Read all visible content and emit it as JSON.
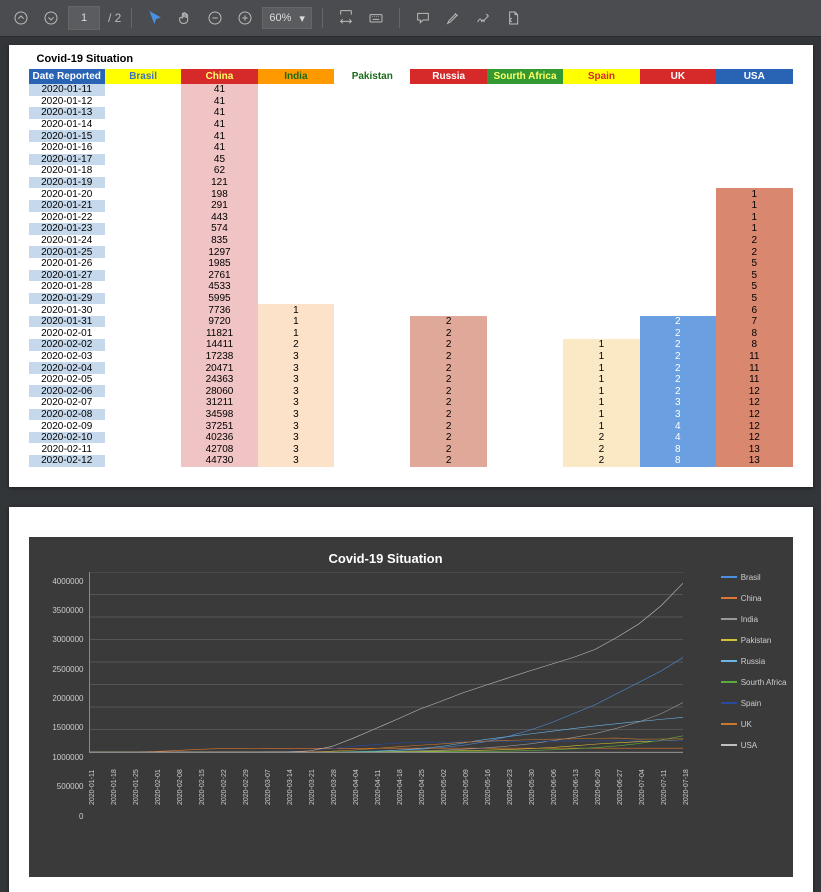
{
  "toolbar": {
    "page_current": "1",
    "page_total": "/ 2",
    "zoom": "60%"
  },
  "doc_title": "Covid-19 Situation",
  "columns": [
    {
      "key": "date",
      "label": "Date Reported",
      "bg": "#2963b4",
      "fg": "#ffffff"
    },
    {
      "key": "brasil",
      "label": "Brasil",
      "bg": "#ffff00",
      "fg": "#4070c0"
    },
    {
      "key": "china",
      "label": "China",
      "bg": "#d62a2a",
      "fg": "#ffff66"
    },
    {
      "key": "india",
      "label": "India",
      "bg": "#ff9900",
      "fg": "#1a6b1a"
    },
    {
      "key": "pakistan",
      "label": "Pakistan",
      "bg": "#ffffff",
      "fg": "#1a6b1a"
    },
    {
      "key": "russia",
      "label": "Russia",
      "bg": "#d62a2a",
      "fg": "#ffffff"
    },
    {
      "key": "sa",
      "label": "Sourth Africa",
      "bg": "#339933",
      "fg": "#ffff66"
    },
    {
      "key": "spain",
      "label": "Spain",
      "bg": "#ffff00",
      "fg": "#d62a2a"
    },
    {
      "key": "uk",
      "label": "UK",
      "bg": "#d62a2a",
      "fg": "#ffffff"
    },
    {
      "key": "usa",
      "label": "USA",
      "bg": "#2963b4",
      "fg": "#ffffff"
    }
  ],
  "cell_bg": {
    "china": "#f0c4c4",
    "india": "#fbe2c8",
    "russia": "#e0a898",
    "spain": "#fbe9c6",
    "uk": "#6aa0e2",
    "usa": "#d9886f"
  },
  "rows": [
    {
      "date": "2020-01-11",
      "china": "41"
    },
    {
      "date": "2020-01-12",
      "china": "41"
    },
    {
      "date": "2020-01-13",
      "china": "41"
    },
    {
      "date": "2020-01-14",
      "china": "41"
    },
    {
      "date": "2020-01-15",
      "china": "41"
    },
    {
      "date": "2020-01-16",
      "china": "41"
    },
    {
      "date": "2020-01-17",
      "china": "45"
    },
    {
      "date": "2020-01-18",
      "china": "62"
    },
    {
      "date": "2020-01-19",
      "china": "121"
    },
    {
      "date": "2020-01-20",
      "china": "198",
      "usa": "1"
    },
    {
      "date": "2020-01-21",
      "china": "291",
      "usa": "1"
    },
    {
      "date": "2020-01-22",
      "china": "443",
      "usa": "1"
    },
    {
      "date": "2020-01-23",
      "china": "574",
      "usa": "1"
    },
    {
      "date": "2020-01-24",
      "china": "835",
      "usa": "2"
    },
    {
      "date": "2020-01-25",
      "china": "1297",
      "usa": "2"
    },
    {
      "date": "2020-01-26",
      "china": "1985",
      "usa": "5"
    },
    {
      "date": "2020-01-27",
      "china": "2761",
      "usa": "5"
    },
    {
      "date": "2020-01-28",
      "china": "4533",
      "usa": "5"
    },
    {
      "date": "2020-01-29",
      "china": "5995",
      "usa": "5"
    },
    {
      "date": "2020-01-30",
      "china": "7736",
      "india": "1",
      "usa": "6"
    },
    {
      "date": "2020-01-31",
      "china": "9720",
      "india": "1",
      "russia": "2",
      "uk": "2",
      "usa": "7"
    },
    {
      "date": "2020-02-01",
      "china": "11821",
      "india": "1",
      "russia": "2",
      "uk": "2",
      "usa": "8"
    },
    {
      "date": "2020-02-02",
      "china": "14411",
      "india": "2",
      "russia": "2",
      "spain": "1",
      "uk": "2",
      "usa": "8"
    },
    {
      "date": "2020-02-03",
      "china": "17238",
      "india": "3",
      "russia": "2",
      "spain": "1",
      "uk": "2",
      "usa": "11"
    },
    {
      "date": "2020-02-04",
      "china": "20471",
      "india": "3",
      "russia": "2",
      "spain": "1",
      "uk": "2",
      "usa": "11"
    },
    {
      "date": "2020-02-05",
      "china": "24363",
      "india": "3",
      "russia": "2",
      "spain": "1",
      "uk": "2",
      "usa": "11"
    },
    {
      "date": "2020-02-06",
      "china": "28060",
      "india": "3",
      "russia": "2",
      "spain": "1",
      "uk": "2",
      "usa": "12"
    },
    {
      "date": "2020-02-07",
      "china": "31211",
      "india": "3",
      "russia": "2",
      "spain": "1",
      "uk": "3",
      "usa": "12"
    },
    {
      "date": "2020-02-08",
      "china": "34598",
      "india": "3",
      "russia": "2",
      "spain": "1",
      "uk": "3",
      "usa": "12"
    },
    {
      "date": "2020-02-09",
      "china": "37251",
      "india": "3",
      "russia": "2",
      "spain": "1",
      "uk": "4",
      "usa": "12"
    },
    {
      "date": "2020-02-10",
      "china": "40236",
      "india": "3",
      "russia": "2",
      "spain": "2",
      "uk": "4",
      "usa": "12"
    },
    {
      "date": "2020-02-11",
      "china": "42708",
      "india": "3",
      "russia": "2",
      "spain": "2",
      "uk": "8",
      "usa": "13"
    },
    {
      "date": "2020-02-12",
      "china": "44730",
      "india": "3",
      "russia": "2",
      "spain": "2",
      "uk": "8",
      "usa": "13"
    }
  ],
  "chart_data": {
    "type": "line",
    "title": "Covid-19 Situation",
    "ylabel": "",
    "xlabel": "",
    "ylim": [
      0,
      4000000
    ],
    "yticks": [
      0,
      500000,
      1000000,
      1500000,
      2000000,
      2500000,
      3000000,
      3500000,
      4000000
    ],
    "x": [
      "2020-01-11",
      "2020-01-18",
      "2020-01-25",
      "2020-02-01",
      "2020-02-08",
      "2020-02-15",
      "2020-02-22",
      "2020-02-29",
      "2020-03-07",
      "2020-03-14",
      "2020-03-21",
      "2020-03-28",
      "2020-04-04",
      "2020-04-11",
      "2020-04-18",
      "2020-04-25",
      "2020-05-02",
      "2020-05-09",
      "2020-05-16",
      "2020-05-23",
      "2020-05-30",
      "2020-06-06",
      "2020-06-13",
      "2020-06-20",
      "2020-06-27",
      "2020-07-04",
      "2020-07-11",
      "2020-07-18"
    ],
    "series": [
      {
        "name": "Brasil",
        "color": "#4a90e2",
        "values": [
          0,
          0,
          0,
          0,
          0,
          0,
          0,
          0,
          0,
          0,
          500,
          3000,
          10000,
          20000,
          40000,
          60000,
          100000,
          150000,
          230000,
          340000,
          480000,
          650000,
          850000,
          1050000,
          1300000,
          1550000,
          1800000,
          2100000
        ]
      },
      {
        "name": "China",
        "color": "#e0762f",
        "values": [
          41,
          62,
          1297,
          11821,
          34598,
          60000,
          77000,
          80000,
          81000,
          81500,
          82000,
          82500,
          83000,
          83300,
          83800,
          84000,
          84100,
          84200,
          84300,
          84400,
          84500,
          84600,
          84700,
          84800,
          84900,
          85000,
          85100,
          85200
        ]
      },
      {
        "name": "India",
        "color": "#999999",
        "values": [
          0,
          0,
          0,
          1,
          3,
          3,
          3,
          3,
          40,
          100,
          350,
          900,
          3000,
          8000,
          16000,
          27000,
          40000,
          63000,
          90000,
          130000,
          180000,
          245000,
          320000,
          410000,
          530000,
          670000,
          850000,
          1100000
        ]
      },
      {
        "name": "Pakistan",
        "color": "#d4c233",
        "values": [
          0,
          0,
          0,
          0,
          0,
          0,
          0,
          0,
          0,
          30,
          600,
          1500,
          3000,
          5000,
          8000,
          13000,
          20000,
          30000,
          40000,
          54000,
          72000,
          100000,
          135000,
          175000,
          205000,
          230000,
          250000,
          265000
        ]
      },
      {
        "name": "Russia",
        "color": "#6bb5e8",
        "values": [
          0,
          0,
          0,
          2,
          2,
          2,
          2,
          2,
          15,
          60,
          260,
          1500,
          5000,
          14000,
          40000,
          75000,
          125000,
          200000,
          280000,
          340000,
          400000,
          460000,
          520000,
          580000,
          630000,
          680000,
          725000,
          770000
        ]
      },
      {
        "name": "Sourth Africa",
        "color": "#5aad3a",
        "values": [
          0,
          0,
          0,
          0,
          0,
          0,
          0,
          0,
          0,
          25,
          250,
          1200,
          1700,
          2200,
          3000,
          4500,
          6300,
          9500,
          14000,
          21000,
          32000,
          48000,
          70000,
          95000,
          135000,
          190000,
          265000,
          360000
        ]
      },
      {
        "name": "Spain",
        "color": "#2a4aa0",
        "values": [
          0,
          0,
          0,
          0,
          1,
          2,
          2,
          30,
          400,
          6000,
          25000,
          75000,
          130000,
          165000,
          195000,
          220000,
          218000,
          224000,
          231000,
          235000,
          239000,
          241000,
          243000,
          246000,
          248000,
          250000,
          253000,
          260000
        ]
      },
      {
        "name": "UK",
        "color": "#c87a2f",
        "values": [
          0,
          0,
          0,
          2,
          3,
          9,
          13,
          23,
          200,
          1150,
          5000,
          17000,
          42000,
          79000,
          115000,
          150000,
          180000,
          215000,
          240000,
          258000,
          272000,
          285000,
          293000,
          303000,
          310000,
          285000,
          289000,
          294000
        ]
      },
      {
        "name": "USA",
        "color": "#bfbfbf",
        "values": [
          0,
          0,
          2,
          8,
          12,
          15,
          15,
          70,
          350,
          2700,
          25000,
          120000,
          310000,
          520000,
          730000,
          950000,
          1130000,
          1320000,
          1480000,
          1640000,
          1800000,
          1950000,
          2100000,
          2280000,
          2550000,
          2850000,
          3250000,
          3750000
        ]
      }
    ]
  }
}
